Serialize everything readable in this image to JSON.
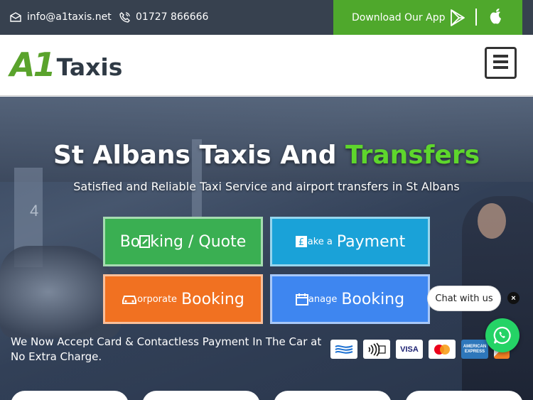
{
  "topbar": {
    "email": "info@a1taxis.net",
    "phone": "01727 866666",
    "app_label": "Download Our App"
  },
  "header": {
    "logo_a1": "A1",
    "logo_taxis": "Taxis"
  },
  "hero": {
    "title_main": "St Albans Taxis And ",
    "title_accent": "Transfers",
    "subtitle": "Satisfied and Reliable Taxi Service and airport transfers in St Albans",
    "buttons": {
      "booking": {
        "prefix": "Bo",
        "suffix": "king / Quote"
      },
      "payment": {
        "small": "ake a",
        "big": "Payment"
      },
      "corporate": {
        "small": "orporate",
        "big": "Booking"
      },
      "manage": {
        "small": "anage",
        "big": "Booking"
      }
    },
    "card_note": "We Now Accept Card & Contactless Payment In The Car at No Extra Charge.",
    "pay_icons": [
      "",
      "",
      "VISA",
      "",
      "AMERICAN EXPRESS",
      ""
    ]
  },
  "chat": {
    "label": "Chat with us",
    "close": "×"
  },
  "colors": {
    "topbar": "#37414f",
    "app_green": "#4fa82c",
    "accent_green": "#5ed62c",
    "booking_green": "#3aaf52",
    "payment_blue": "#1aa2d8",
    "corporate_orange": "#f17121",
    "manage_blue": "#3e86f0",
    "whatsapp": "#25d366"
  }
}
